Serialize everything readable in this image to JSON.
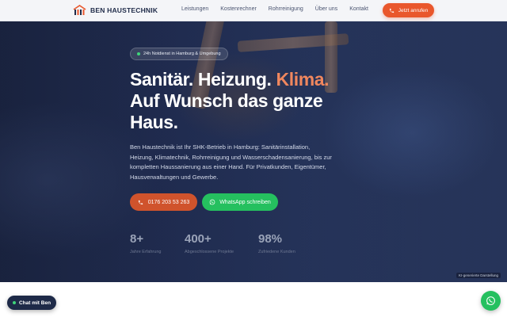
{
  "brand": {
    "name": "BEN HAUSTECHNIK"
  },
  "nav": {
    "links": [
      "Leistungen",
      "Kostenrechner",
      "Rohrreinigung",
      "Über uns",
      "Kontakt"
    ],
    "cta_label": "Jetzt anrufen"
  },
  "hero": {
    "badge": "24h Notdienst in Hamburg & Umgebung",
    "headline_part1": "Sanitär. Heizung. ",
    "headline_accent": "Klima.",
    "headline_part2": "Auf Wunsch das ganze Haus.",
    "lead": "Ben Haustechnik ist Ihr SHK-Betrieb in Hamburg: Sanitärinstallation, Heizung, Klimatechnik, Rohrreinigung und Wasserschadensanierung, bis zur kompletten Haussanierung aus einer Hand. Für Privatkunden, Eigentümer, Hausverwaltungen und Gewerbe.",
    "phone_button": "0176 203 53 263",
    "whatsapp_button": "WhatsApp schreiben",
    "stats": [
      {
        "value": "8+",
        "label": "Jahre Erfahrung"
      },
      {
        "value": "400+",
        "label": "Abgeschlossene Projekte"
      },
      {
        "value": "98%",
        "label": "Zufriedene Kunden"
      }
    ],
    "ai_note": "KI-generierte Darstellung"
  },
  "floating": {
    "chat_label": "Chat mit Ben"
  },
  "colors": {
    "accent": "#e9572c",
    "whatsapp": "#25c05f",
    "navy": "#1e2a48",
    "headline_accent": "#f0875e"
  },
  "icons": {
    "logo": "house-pipes-logo-icon",
    "phone": "phone-icon",
    "whatsapp": "whatsapp-icon"
  }
}
